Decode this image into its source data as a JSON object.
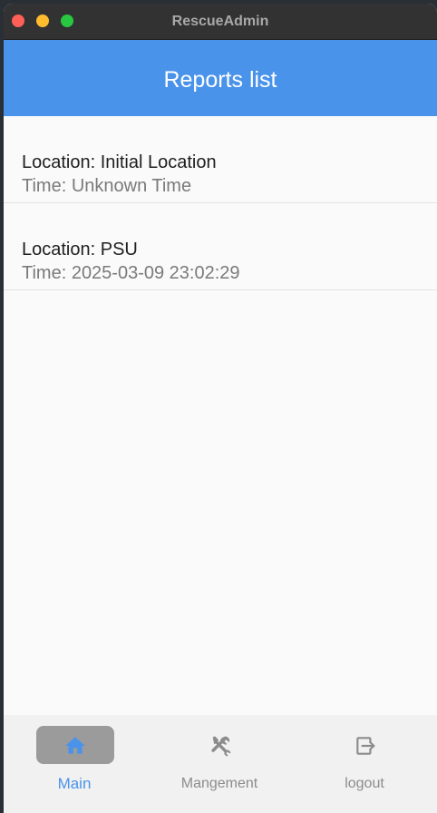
{
  "window": {
    "title": "RescueAdmin"
  },
  "appbar": {
    "title": "Reports list"
  },
  "reports": [
    {
      "location": "Location: Initial Location",
      "time": "Time: Unknown Time"
    },
    {
      "location": "Location: PSU",
      "time": "Time: 2025-03-09 23:02:29"
    }
  ],
  "nav": {
    "items": [
      {
        "label": "Main",
        "icon": "home-icon",
        "active": true
      },
      {
        "label": "Mangement",
        "icon": "tools-icon",
        "active": false
      },
      {
        "label": "logout",
        "icon": "logout-icon",
        "active": false
      }
    ]
  },
  "colors": {
    "accent": "#4a93ea",
    "titlebar": "#323232",
    "nav_background": "#f1f1f1",
    "active_pill": "#9b9b9b",
    "inactive_icon": "#8c8c8c"
  }
}
